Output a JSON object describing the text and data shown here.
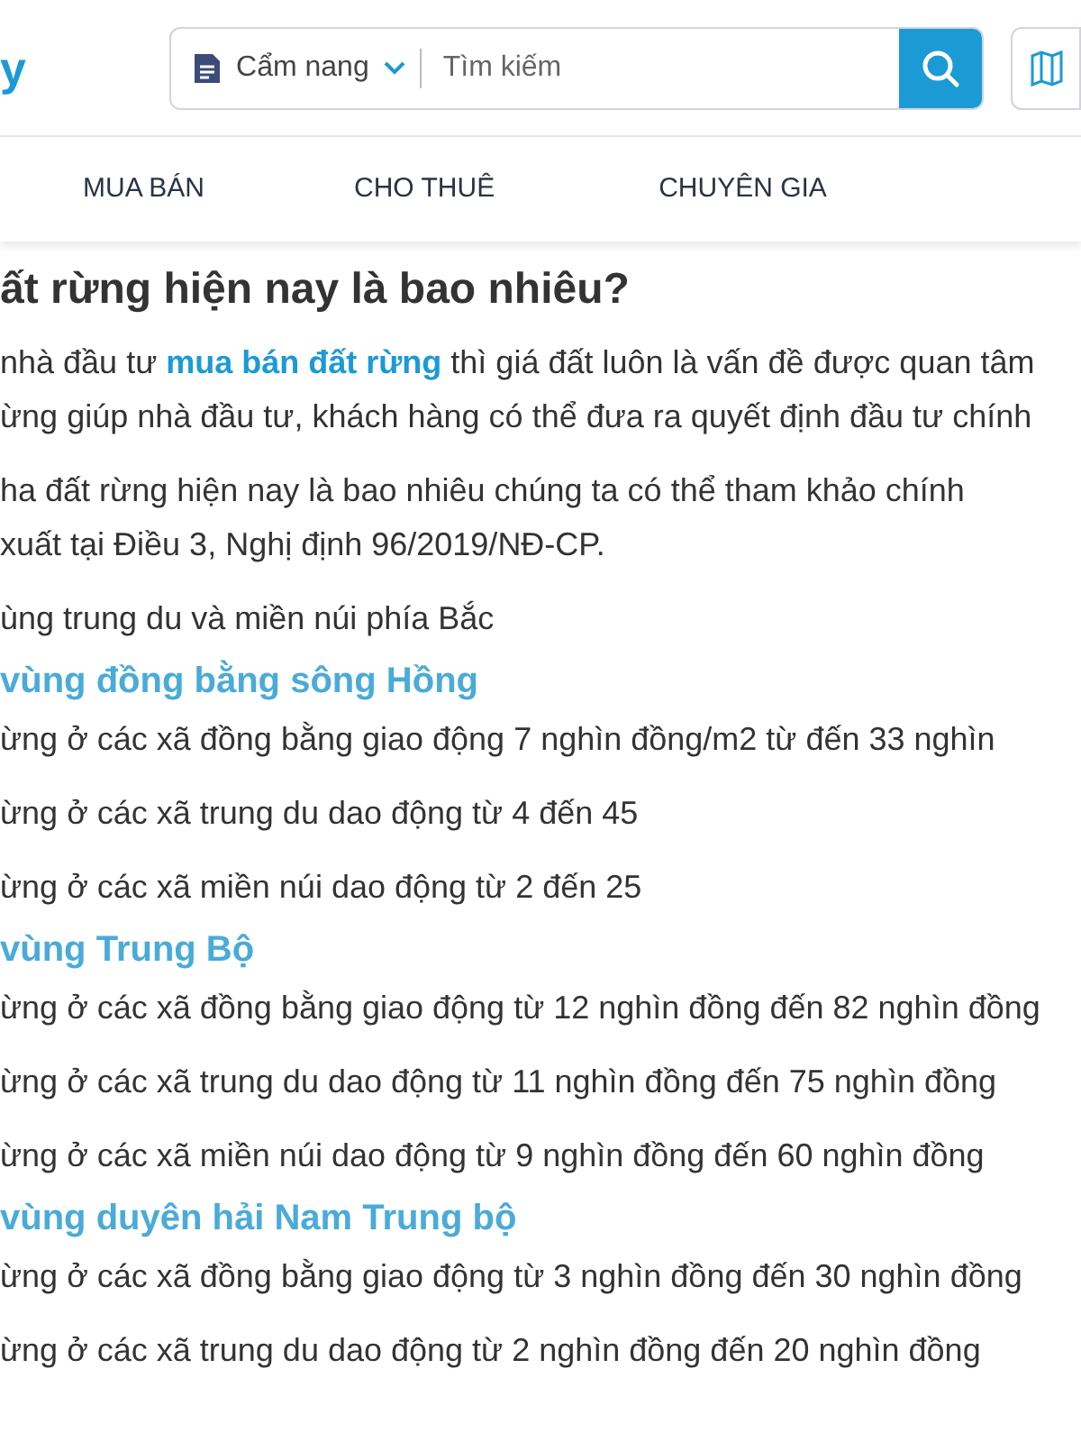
{
  "header": {
    "logo_fragment": "y",
    "search": {
      "category": "Cẩm nang",
      "placeholder": "Tìm kiếm"
    }
  },
  "nav": {
    "items": [
      {
        "label": "MUA BÁN"
      },
      {
        "label": "CHO THUÊ"
      },
      {
        "label": "CHUYÊN GIA"
      }
    ]
  },
  "article": {
    "title": "ất rừng hiện nay là bao nhiêu?",
    "blocks": [
      {
        "kind": "paragraph",
        "lines": [
          [
            {
              "text": "nhà đầu tư "
            },
            {
              "text": "mua bán đất rừng",
              "link": true
            },
            {
              "text": " thì giá đất luôn là vấn đề được quan tâm"
            }
          ],
          [
            {
              "text": "ừng giúp nhà đầu tư, khách hàng có thể đưa ra quyết định đầu tư chính"
            }
          ]
        ]
      },
      {
        "kind": "paragraph",
        "lines": [
          [
            {
              "text": "ha đất rừng hiện nay là bao nhiêu chúng ta có thể tham khảo chính"
            }
          ],
          [
            {
              "text": "xuất tại Điều 3, Nghị định 96/2019/NĐ-CP."
            }
          ]
        ]
      },
      {
        "kind": "paragraph",
        "lines": [
          [
            {
              "text": "ùng trung du và miền núi phía Bắc"
            }
          ]
        ]
      },
      {
        "kind": "heading",
        "text": "vùng đồng bằng sông Hồng"
      },
      {
        "kind": "paragraph",
        "lines": [
          [
            {
              "text": "ừng ở các xã đồng bằng giao động 7 nghìn đồng/m2 từ đến 33 nghìn"
            }
          ]
        ]
      },
      {
        "kind": "paragraph",
        "lines": [
          [
            {
              "text": "ừng ở các xã trung du dao động từ 4 đến 45"
            }
          ]
        ]
      },
      {
        "kind": "paragraph",
        "lines": [
          [
            {
              "text": "ừng ở các xã miền núi dao động từ 2 đến 25"
            }
          ]
        ]
      },
      {
        "kind": "heading",
        "text": "vùng Trung Bộ"
      },
      {
        "kind": "paragraph",
        "lines": [
          [
            {
              "text": "ừng ở các xã đồng bằng giao động từ 12 nghìn đồng đến 82 nghìn đồng"
            }
          ]
        ]
      },
      {
        "kind": "paragraph",
        "lines": [
          [
            {
              "text": "ừng ở các xã trung du dao động từ 11 nghìn đồng đến 75 nghìn đồng"
            }
          ]
        ]
      },
      {
        "kind": "paragraph",
        "lines": [
          [
            {
              "text": "ừng ở các xã miền núi dao động từ 9 nghìn đồng đến 60 nghìn đồng"
            }
          ]
        ]
      },
      {
        "kind": "heading",
        "text": "vùng duyên hải Nam Trung bộ"
      },
      {
        "kind": "paragraph",
        "lines": [
          [
            {
              "text": "ừng ở các xã đồng bằng giao động từ 3 nghìn đồng đến 30 nghìn đồng"
            }
          ]
        ]
      },
      {
        "kind": "paragraph",
        "lines": [
          [
            {
              "text": "ừng ở các xã trung du dao động từ 2 nghìn đồng đến 20 nghìn đồng"
            }
          ]
        ]
      }
    ]
  }
}
